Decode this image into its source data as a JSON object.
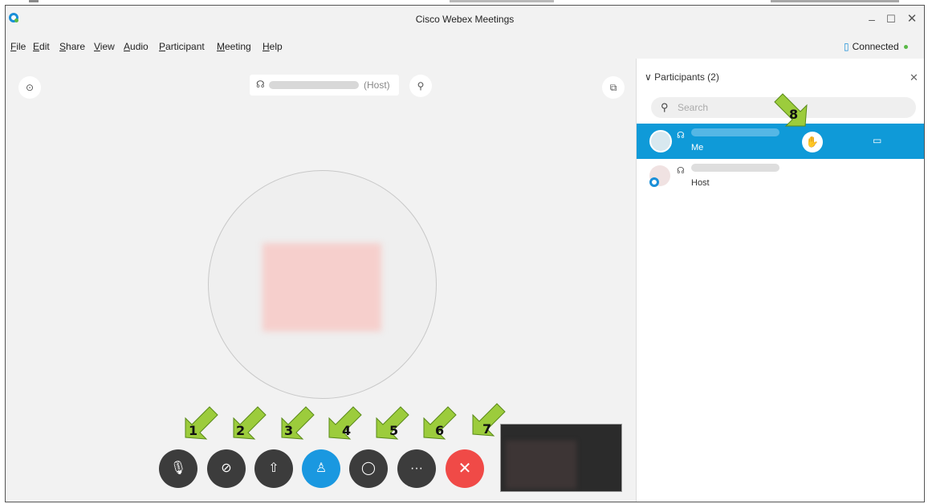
{
  "window": {
    "title": "Cisco Webex Meetings",
    "minimize_icon": "minimize-icon",
    "maximize_icon": "maximize-icon",
    "close_icon": "close-icon"
  },
  "menu": [
    {
      "label": "File",
      "mnemonic": "F",
      "rest": "ile"
    },
    {
      "label": "Edit",
      "mnemonic": "E",
      "rest": "dit"
    },
    {
      "label": "Share",
      "mnemonic": "S",
      "rest": "hare"
    },
    {
      "label": "View",
      "mnemonic": "V",
      "rest": "iew"
    },
    {
      "label": "Audio",
      "mnemonic": "A",
      "rest": "udio"
    },
    {
      "label": "Participant",
      "mnemonic": "P",
      "rest": "articipant"
    },
    {
      "label": "Meeting",
      "mnemonic": "M",
      "rest": "eeting"
    },
    {
      "label": "Help",
      "mnemonic": "H",
      "rest": "elp"
    }
  ],
  "status": {
    "text": "Connected",
    "dot_color": "#59b947"
  },
  "stage": {
    "host_label": "(Host)",
    "controls": [
      {
        "name": "mute-button",
        "icon": "mic-off-icon",
        "glyph": "🎙"
      },
      {
        "name": "stop-video-button",
        "icon": "video-off-icon",
        "glyph": "▭"
      },
      {
        "name": "share-button",
        "icon": "share-icon",
        "glyph": "⇧"
      },
      {
        "name": "participants-button",
        "icon": "participants-icon",
        "glyph": "♙"
      },
      {
        "name": "chat-button",
        "icon": "chat-icon",
        "glyph": "◯"
      },
      {
        "name": "more-options-button",
        "icon": "more-icon",
        "glyph": "···"
      },
      {
        "name": "leave-meeting-button",
        "icon": "close-icon",
        "glyph": "✕"
      }
    ],
    "arrow_labels": [
      "1",
      "2",
      "3",
      "4",
      "5",
      "6",
      "7",
      "8"
    ]
  },
  "panel": {
    "title": "Participants (2)",
    "search_placeholder": "Search",
    "participants": [
      {
        "role": "Me",
        "selected": true
      },
      {
        "role": "Host",
        "selected": false
      }
    ]
  },
  "colors": {
    "accent": "#1a98e0",
    "leave": "#f04a47",
    "arrow_fill": "#9ccc3c",
    "selected_row": "#0f9ad8"
  }
}
